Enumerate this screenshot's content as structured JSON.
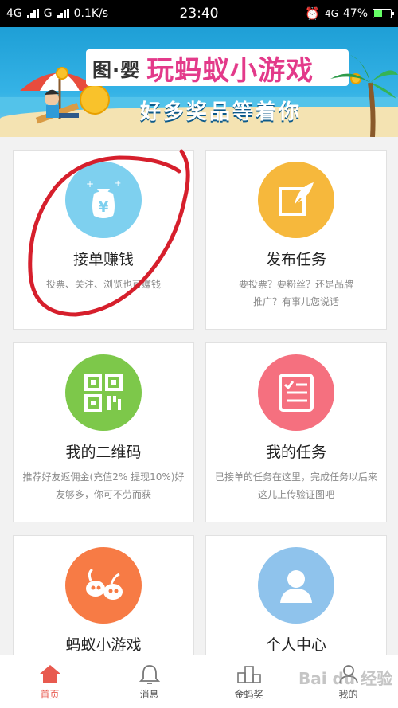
{
  "status_bar": {
    "network1": "4G",
    "network2": "G",
    "speed": "0.1K/s",
    "time": "23:40",
    "network3": "4G",
    "battery_percent": "47%",
    "battery_level": 0.47
  },
  "banner": {
    "title_prefix": "图·婴",
    "title": "玩蚂蚁小游戏",
    "subtitle": "好多奖品等着你"
  },
  "cards": [
    {
      "title": "接单赚钱",
      "desc": "投票、关注、浏览也可赚钱",
      "icon": "money-bag-icon",
      "color": "#7ed0ef"
    },
    {
      "title": "发布任务",
      "desc": "要投票？要粉丝？还是品牌推广？有事儿您说话",
      "icon": "edit-feather-icon",
      "color": "#f6b83c"
    },
    {
      "title": "我的二维码",
      "desc": "推荐好友返佣金(充值2% 提现10%)好友够多，你可不劳而获",
      "icon": "qr-code-icon",
      "color": "#7dc84a"
    },
    {
      "title": "我的任务",
      "desc": "已接单的任务在这里，完成任务以后来这儿上传验证图吧",
      "icon": "task-list-icon",
      "color": "#f5707f"
    },
    {
      "title": "蚂蚁小游戏",
      "desc": "",
      "icon": "ant-game-icon",
      "color": "#f77b45"
    },
    {
      "title": "个人中心",
      "desc": "",
      "icon": "user-profile-icon",
      "color": "#8fc3ec"
    }
  ],
  "nav": {
    "home": "首页",
    "messages": "消息",
    "gold_ant": "金蚂奖",
    "mine": "我的"
  },
  "watermark": "Bai du 经验",
  "colors": {
    "accent": "#e85a4f",
    "annotation": "#d61f2c"
  }
}
